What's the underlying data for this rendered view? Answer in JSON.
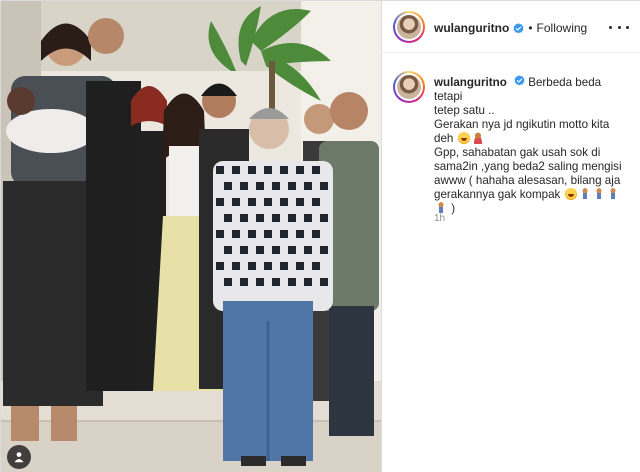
{
  "post": {
    "username": "wulanguritno",
    "verified": true,
    "follow_state": "Following",
    "separator": "•"
  },
  "caption": {
    "username": "wulanguritno",
    "lines": [
      "Berbeda beda tetapi",
      "tetep satu ..",
      "Gerakan nya jd ngikutin motto kita",
      "deh",
      "Gpp, sahabatan gak usah sok di",
      "sama2in ,yang beda2 saling mengisi",
      "awww ( hahaha alesasan, bilang aja",
      "gerakannya gak kompak",
      ")"
    ],
    "emoji_line4": [
      "laugh-emoji",
      "woman-emoji"
    ],
    "emoji_line8": [
      "laugh-emoji",
      "dancer-emoji",
      "dancer-emoji",
      "dancer-emoji"
    ],
    "emoji_line9": [
      "dancer-emoji"
    ],
    "timestamp": "1h"
  },
  "icons": {
    "user_tag": "user-tag-icon",
    "verified": "verified-badge-icon",
    "more": "more-options-icon"
  },
  "colors": {
    "accent_blue": "#3897f0",
    "text": "#262626",
    "secondary_text": "#8e8e8e",
    "border": "#dbdbdb"
  }
}
